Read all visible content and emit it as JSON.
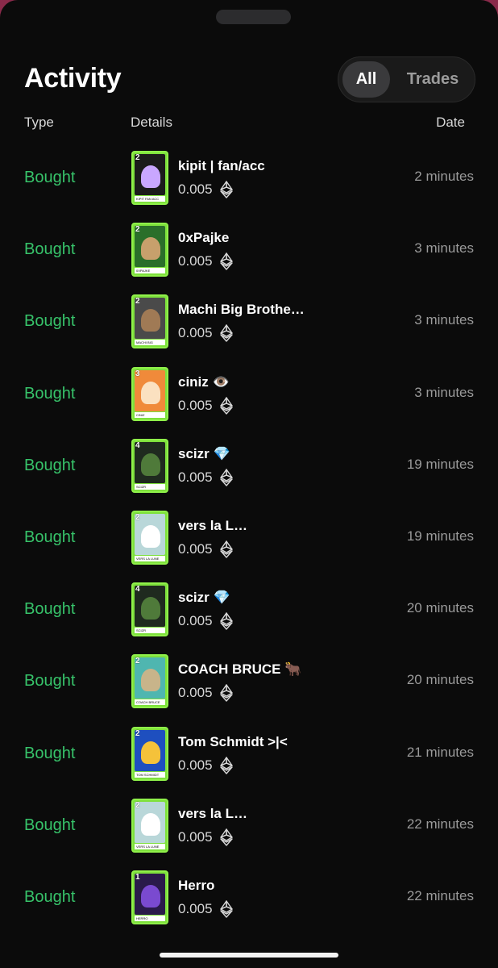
{
  "header": {
    "title": "Activity",
    "filters": [
      {
        "label": "All",
        "selected": true
      },
      {
        "label": "Trades",
        "selected": false
      }
    ]
  },
  "columns": {
    "type": "Type",
    "details": "Details",
    "date": "Date"
  },
  "rows": [
    {
      "type": "Bought",
      "name": "kipit | fan/acc",
      "price": "0.005",
      "date": "2 minutes",
      "level": "2",
      "art": "#1b1b1b",
      "fig": "#c9a7ff",
      "card_label": "KIPIT FAN ACC"
    },
    {
      "type": "Bought",
      "name": "0xPajke",
      "price": "0.005",
      "date": "3 minutes",
      "level": "2",
      "art": "#2a6f2a",
      "fig": "#c7a06c",
      "card_label": "0XPAJKE"
    },
    {
      "type": "Bought",
      "name": "Machi Big Brothe…",
      "price": "0.005",
      "date": "3 minutes",
      "level": "2",
      "art": "#4a4a4a",
      "fig": "#a07a55",
      "card_label": "MACHI BIG BROTHER"
    },
    {
      "type": "Bought",
      "name": "ciniz 👁️",
      "price": "0.005",
      "date": "3 minutes",
      "level": "3",
      "art": "#f08a3a",
      "fig": "#fbe1c0",
      "card_label": "CINIZ"
    },
    {
      "type": "Bought",
      "name": "scizr 💎",
      "price": "0.005",
      "date": "19 minutes",
      "level": "4",
      "art": "#1f2a1f",
      "fig": "#4f7a3a",
      "card_label": "SCIZR"
    },
    {
      "type": "Bought",
      "name": "vers la L…",
      "price": "0.005",
      "date": "19 minutes",
      "level": "2",
      "art": "#b9d7d9",
      "fig": "#ffffff",
      "card_label": "VERS LA LUNE"
    },
    {
      "type": "Bought",
      "name": "scizr 💎",
      "price": "0.005",
      "date": "20 minutes",
      "level": "4",
      "art": "#1f2a1f",
      "fig": "#4f7a3a",
      "card_label": "SCIZR"
    },
    {
      "type": "Bought",
      "name": "COACH BRUCE 🐂",
      "price": "0.005",
      "date": "20 minutes",
      "level": "2",
      "art": "#4fb6b0",
      "fig": "#c8b48a",
      "card_label": "COACH BRUCE"
    },
    {
      "type": "Bought",
      "name": "Tom Schmidt >|<",
      "price": "0.005",
      "date": "21 minutes",
      "level": "2",
      "art": "#1e4fbf",
      "fig": "#f5c23a",
      "card_label": "TOM SCHMIDT"
    },
    {
      "type": "Bought",
      "name": "vers la L…",
      "price": "0.005",
      "date": "22 minutes",
      "level": "2",
      "art": "#b9d7d9",
      "fig": "#ffffff",
      "card_label": "VERS LA LUNE"
    },
    {
      "type": "Bought",
      "name": "Herro",
      "price": "0.005",
      "date": "22 minutes",
      "level": "1",
      "art": "#2a1a4a",
      "fig": "#7a4ad0",
      "card_label": "HERRO"
    }
  ],
  "colors": {
    "background": "#0b0b0b",
    "bought": "#37c36a",
    "card_border": "#8ff04a",
    "muted": "#9a9a9a"
  },
  "icons": {
    "currency": "ethereum-icon"
  }
}
